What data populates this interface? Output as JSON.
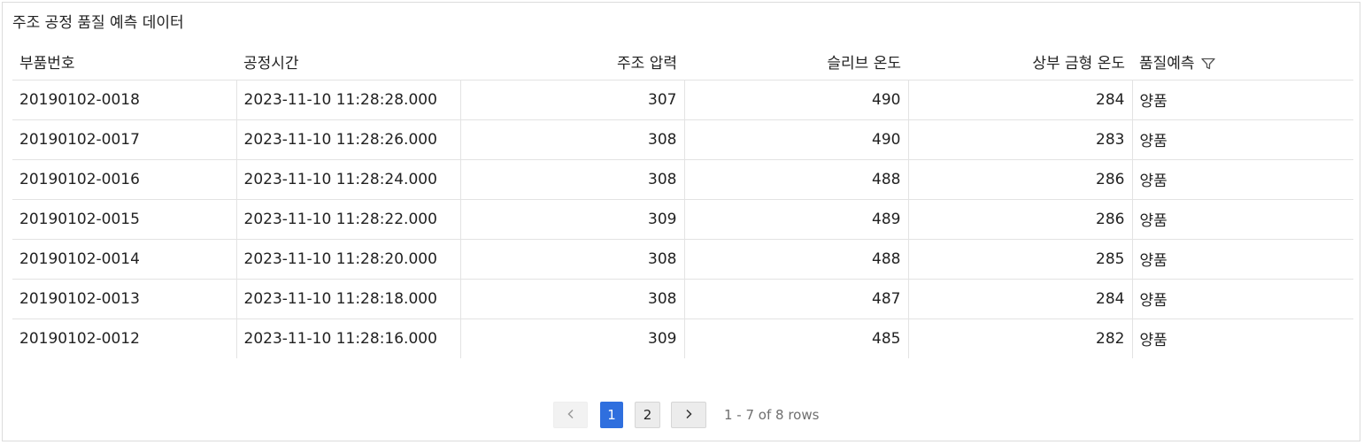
{
  "panel": {
    "title": "주조 공정 품질 예측 데이터"
  },
  "table": {
    "columns": [
      {
        "label": "부품번호"
      },
      {
        "label": "공정시간"
      },
      {
        "label": "주조 압력"
      },
      {
        "label": "슬리브 온도"
      },
      {
        "label": "상부 금형 온도"
      },
      {
        "label": "품질예측",
        "icon": "filter-icon"
      }
    ],
    "rows": [
      [
        "20190102-0018",
        "2023-11-10 11:28:28.000",
        "307",
        "490",
        "284",
        "양품"
      ],
      [
        "20190102-0017",
        "2023-11-10 11:28:26.000",
        "308",
        "490",
        "283",
        "양품"
      ],
      [
        "20190102-0016",
        "2023-11-10 11:28:24.000",
        "308",
        "488",
        "286",
        "양품"
      ],
      [
        "20190102-0015",
        "2023-11-10 11:28:22.000",
        "309",
        "489",
        "286",
        "양품"
      ],
      [
        "20190102-0014",
        "2023-11-10 11:28:20.000",
        "308",
        "488",
        "285",
        "양품"
      ],
      [
        "20190102-0013",
        "2023-11-10 11:28:18.000",
        "308",
        "487",
        "284",
        "양품"
      ],
      [
        "20190102-0012",
        "2023-11-10 11:28:16.000",
        "309",
        "485",
        "282",
        "양품"
      ]
    ]
  },
  "pagination": {
    "prev_icon": "chevron-left-icon",
    "pages": [
      "1",
      "2"
    ],
    "current_page": "1",
    "next_icon": "chevron-right-icon",
    "info": "1 - 7 of 8 rows"
  },
  "colors": {
    "accent": "#2f6fde",
    "border": "#e3e3e3"
  }
}
